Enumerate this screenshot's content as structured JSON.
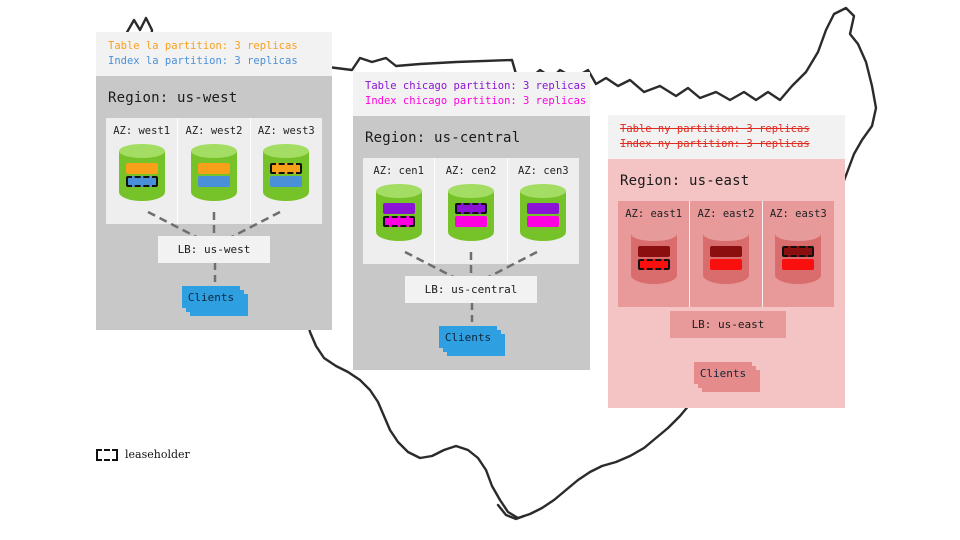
{
  "legend": {
    "label": "leaseholder",
    "swatch_style": "dashed-outline"
  },
  "colors": {
    "panel_gray": "#c8c8c8",
    "panel_light": "#eeeeee",
    "note_bg": "#f2f2f2",
    "panel_pink": "#f4c3c3",
    "az_pink": "#e89a9a",
    "cyl_green_body": "#76c229",
    "cyl_green_top": "#a4dd63",
    "cyl_red_body": "#d96c6c",
    "cyl_red_top": "#e79a9a",
    "table_la": "#f9a01b",
    "index_la": "#4a90d9",
    "table_chicago": "#8a13d6",
    "index_chicago": "#ff00e1",
    "table_ny": "#8b0f0f",
    "index_ny": "#fa0f0f",
    "clients_blue": "#2e9fe0",
    "clients_pink": "#e58b8b",
    "strike_red": "#e02b20",
    "connector_gray": "#6e6e6e",
    "map_outline": "#2b2b2b"
  },
  "regions": [
    {
      "id": "us-west",
      "title": "Region: us-west",
      "status": "healthy",
      "notes": [
        {
          "text": "Table la partition: 3 replicas",
          "color": "#f9a01b",
          "struck": false
        },
        {
          "text": "Index la partition: 3 replicas",
          "color": "#4a90d9",
          "struck": false
        }
      ],
      "azs": [
        {
          "label": "AZ: west1",
          "table_lease": false,
          "index_lease": true
        },
        {
          "label": "AZ: west2",
          "table_lease": false,
          "index_lease": false
        },
        {
          "label": "AZ: west3",
          "table_lease": true,
          "index_lease": false
        }
      ],
      "load_balancer": "LB: us-west",
      "clients": "Clients",
      "connectors_visible": true
    },
    {
      "id": "us-central",
      "title": "Region: us-central",
      "status": "healthy",
      "notes": [
        {
          "text": "Table chicago partition: 3 replicas",
          "color": "#8a13d6",
          "struck": false
        },
        {
          "text": "Index chicago partition: 3 replicas",
          "color": "#ff00e1",
          "struck": false
        }
      ],
      "azs": [
        {
          "label": "AZ: cen1",
          "table_lease": false,
          "index_lease": true
        },
        {
          "label": "AZ: cen2",
          "table_lease": true,
          "index_lease": false
        },
        {
          "label": "AZ: cen3",
          "table_lease": false,
          "index_lease": false
        }
      ],
      "load_balancer": "LB: us-central",
      "clients": "Clients",
      "connectors_visible": true
    },
    {
      "id": "us-east",
      "title": "Region: us-east",
      "status": "failed",
      "notes": [
        {
          "text": "Table ny partition: 3 replicas",
          "color": "#e02b20",
          "struck": true
        },
        {
          "text": "Index ny partition: 3 replicas",
          "color": "#e02b20",
          "struck": true
        }
      ],
      "azs": [
        {
          "label": "AZ: east1",
          "table_lease": false,
          "index_lease": true
        },
        {
          "label": "AZ: east2",
          "table_lease": false,
          "index_lease": false
        },
        {
          "label": "AZ: east3",
          "table_lease": true,
          "index_lease": false
        }
      ],
      "load_balancer": "LB: us-east",
      "clients": "Clients",
      "connectors_visible": false
    }
  ]
}
